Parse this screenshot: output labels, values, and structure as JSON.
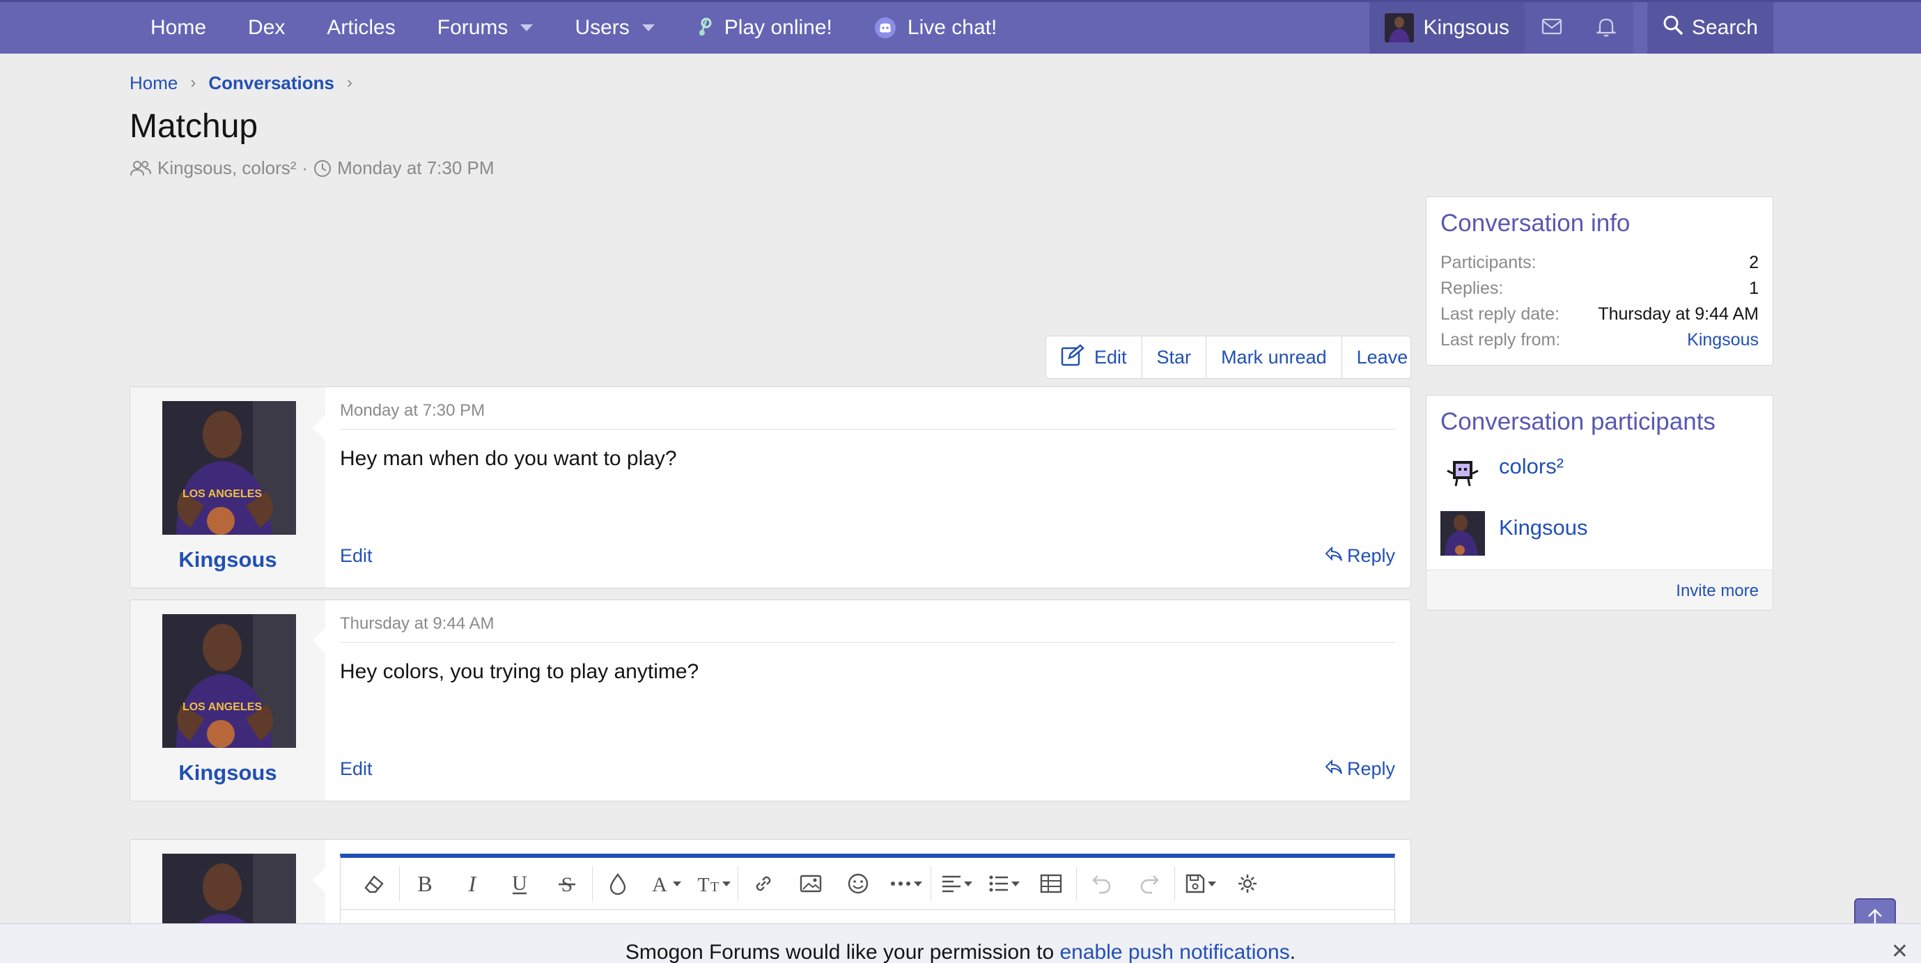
{
  "nav": {
    "home": "Home",
    "dex": "Dex",
    "articles": "Articles",
    "forums": "Forums",
    "users": "Users",
    "play": "Play online!",
    "chat": "Live chat!",
    "username": "Kingsous",
    "search": "Search"
  },
  "breadcrumb": {
    "home": "Home",
    "conversations": "Conversations"
  },
  "title": "Matchup",
  "meta": {
    "participants": "Kingsous, colors²",
    "separator": "·",
    "date": "Monday at 7:30 PM"
  },
  "actions": {
    "edit": "Edit",
    "star": "Star",
    "mark_unread": "Mark unread",
    "leave": "Leave"
  },
  "messages": [
    {
      "author": "Kingsous",
      "date": "Monday at 7:30 PM",
      "text": "Hey man when do you want to play?",
      "edit": "Edit",
      "reply": "Reply"
    },
    {
      "author": "Kingsous",
      "date": "Thursday at 9:44 AM",
      "text": "Hey colors, you trying to play anytime?",
      "edit": "Edit",
      "reply": "Reply"
    }
  ],
  "info": {
    "title": "Conversation info",
    "participants_label": "Participants:",
    "participants": "2",
    "replies_label": "Replies:",
    "replies": "1",
    "last_date_label": "Last reply date:",
    "last_date": "Thursday at 9:44 AM",
    "last_from_label": "Last reply from:",
    "last_from": "Kingsous"
  },
  "participants": {
    "title": "Conversation participants",
    "list": [
      "colors²",
      "Kingsous"
    ],
    "invite": "Invite more"
  },
  "notification": {
    "text": "Smogon Forums would like your permission to ",
    "link": "enable push notifications",
    "end": ".",
    "close": "✕"
  },
  "colors": {
    "nav": "#6565b4",
    "link": "#2150b5",
    "heading": "#5858b0"
  }
}
